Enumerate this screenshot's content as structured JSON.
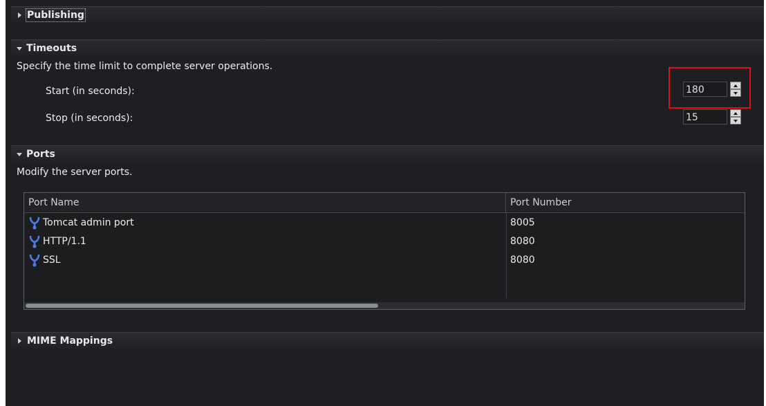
{
  "sections": {
    "publishing": {
      "title": "Publishing"
    },
    "timeouts": {
      "title": "Timeouts",
      "description": "Specify the time limit to complete server operations.",
      "start_label": "Start (in seconds):",
      "start_value": "180",
      "stop_label": "Stop (in seconds):",
      "stop_value": "15"
    },
    "ports": {
      "title": "Ports",
      "description": "Modify the server ports.",
      "columns": [
        "Port Name",
        "Port Number"
      ],
      "rows": [
        {
          "name": "Tomcat admin port",
          "number": "8005",
          "icon": "port-icon"
        },
        {
          "name": "HTTP/1.1",
          "number": "8080",
          "icon": "port-icon"
        },
        {
          "name": "SSL",
          "number": "8080",
          "icon": "port-icon"
        }
      ]
    },
    "mime": {
      "title": "MIME Mappings"
    }
  },
  "colors": {
    "highlight": "#e01010",
    "icon": "#4f79e8",
    "background": "#1e1f22"
  }
}
